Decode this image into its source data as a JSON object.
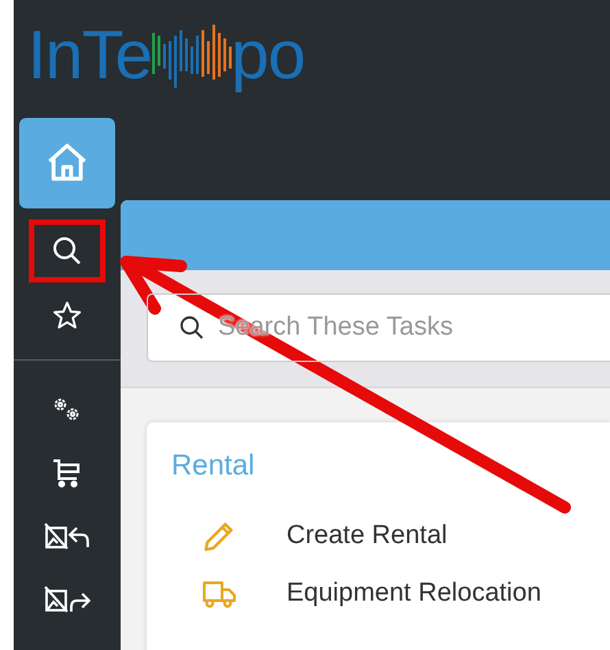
{
  "logo": {
    "left": "InTe",
    "right": "po"
  },
  "sidebar": {
    "top": [
      {
        "kind": "home",
        "selected": true,
        "highlighted": false
      },
      {
        "kind": "search",
        "selected": false,
        "highlighted": true
      },
      {
        "kind": "star",
        "selected": false,
        "highlighted": false
      }
    ],
    "bottom": [
      {
        "kind": "gears",
        "selected": false,
        "highlighted": false
      },
      {
        "kind": "cart",
        "selected": false,
        "highlighted": false
      },
      {
        "kind": "image-back",
        "selected": false,
        "highlighted": false
      },
      {
        "kind": "image-forward",
        "selected": false,
        "highlighted": false
      }
    ]
  },
  "search": {
    "placeholder": "Search These Tasks"
  },
  "section": {
    "title": "Rental",
    "tasks": [
      {
        "kind": "pencil",
        "label": "Create Rental"
      },
      {
        "kind": "truck",
        "label": "Equipment Relocation"
      }
    ]
  }
}
